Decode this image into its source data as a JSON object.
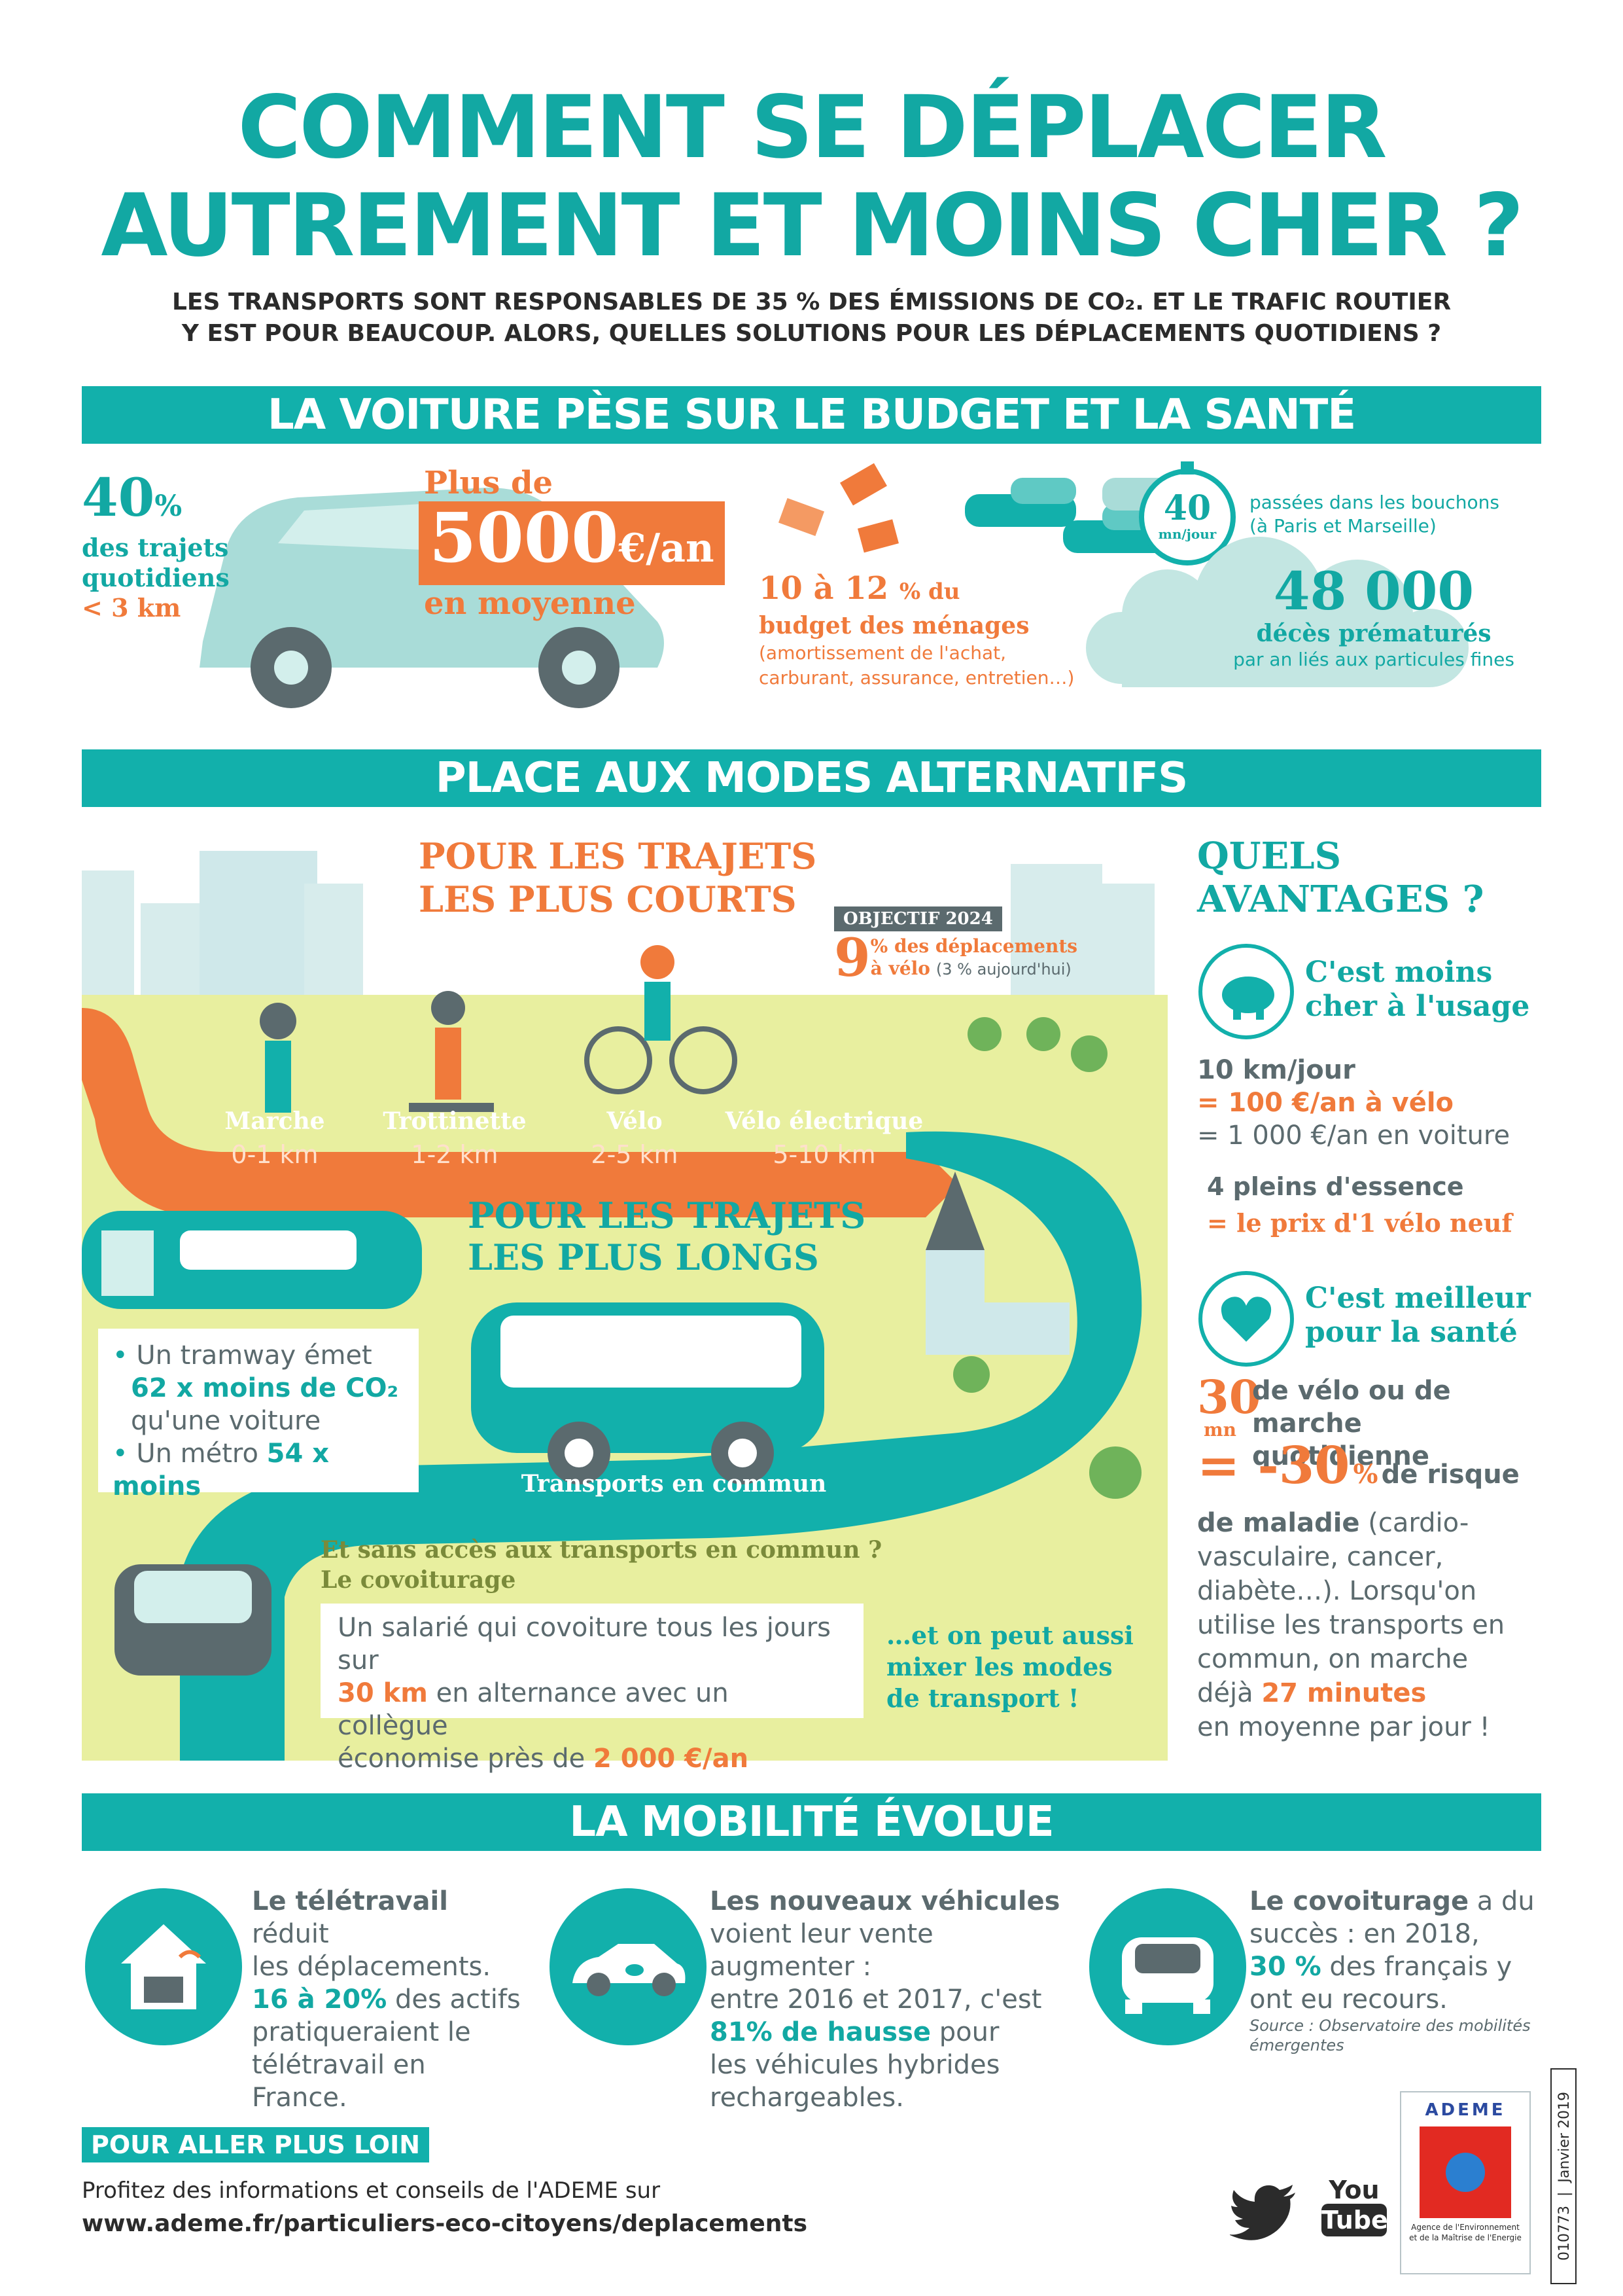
{
  "header": {
    "title_line1": "COMMENT SE DÉPLACER",
    "title_line2": "AUTREMENT ET MOINS CHER ?",
    "subtitle_line1": "LES TRANSPORTS SONT RESPONSABLES DE 35 % DES ÉMISSIONS DE CO₂. ET LE TRAFIC ROUTIER",
    "subtitle_line2": "Y EST POUR BEAUCOUP. ALORS, QUELLES SOLUTIONS POUR LES DÉPLACEMENTS QUOTIDIENS ?"
  },
  "section1": {
    "title": "LA VOITURE PÈSE SUR LE BUDGET ET LA SANTÉ",
    "trips_value": "40",
    "trips_unit": "%",
    "trips_text1": "des trajets",
    "trips_text2": "quotidiens",
    "trips_text3": "< 3 km",
    "cost_prefix": "Plus de",
    "cost_value": "5000",
    "cost_unit": "€/an",
    "cost_suffix": "en moyenne",
    "budget_value": "10 à 12",
    "budget_unit": "% du",
    "budget_text": "budget des ménages",
    "budget_detail1": "(amortissement de l'achat,",
    "budget_detail2": "carburant, assurance, entretien…)",
    "traffic_value": "40",
    "traffic_unit": "mn/jour",
    "traffic_text1": "passées dans les bouchons",
    "traffic_text2": "(à Paris et Marseille)",
    "deaths_value": "48 000",
    "deaths_text1": "décès prématurés",
    "deaths_text2": "par an liés aux particules fines"
  },
  "section2": {
    "title": "PLACE AUX MODES ALTERNATIFS",
    "short_title1": "POUR LES TRAJETS",
    "short_title2": "LES PLUS COURTS",
    "objective_label": "OBJECTIF 2024",
    "objective_value": "9",
    "objective_text1": "% des déplacements",
    "objective_text2": "à vélo",
    "objective_text3": "(3 % aujourd'hui)",
    "modes": [
      {
        "name": "Marche",
        "range": "0-1 km"
      },
      {
        "name": "Trottinette",
        "range": "1-2 km"
      },
      {
        "name": "Vélo",
        "range": "2-5 km"
      },
      {
        "name": "Vélo électrique",
        "range": "5-10 km"
      }
    ],
    "long_title1": "POUR LES TRAJETS",
    "long_title2": "LES PLUS LONGS",
    "tram_line1": "Un tramway émet",
    "tram_line2": "62 x moins de CO₂",
    "tram_line3": "qu'une voiture",
    "metro_prefix": "Un métro",
    "metro_value": "54 x moins",
    "bus_label": "Transports en commun",
    "carpool_q1": "Et sans accès aux transports en commun ?",
    "carpool_q2": "Le covoiturage",
    "carpool_box1": "Un salarié qui covoiture tous les jours sur",
    "carpool_box2a": "30 km",
    "carpool_box2b": "en alternance avec un collègue",
    "carpool_box3a": "économise près de",
    "carpool_box3b": "2 000 €/an",
    "mix1": "…et on peut aussi",
    "mix2": "mixer les modes",
    "mix3": "de transport !"
  },
  "advantages": {
    "title1": "QUELS",
    "title2": "AVANTAGES ?",
    "cheap1": "C'est moins",
    "cheap2": "cher à l'usage",
    "km_line": "10 km/jour",
    "bike_cost": "= 100 €/an à vélo",
    "car_cost": "= 1 000 €/an en voiture",
    "fuel_line": "4 pleins d'essence",
    "fuel_eq": "= le prix d'1 vélo neuf",
    "health1": "C'est meilleur",
    "health2": "pour la santé",
    "minutes_value": "30",
    "minutes_unit": "mn",
    "minutes_text1": "de vélo ou de",
    "minutes_text2": "marche quotidienne",
    "risk_value": "= -30",
    "risk_unit": "%",
    "risk_text": "de risque",
    "disease_bold": "de maladie",
    "disease_text1": "(cardio-",
    "disease_text2": "vasculaire, cancer,",
    "disease_text3": "diabète…). Lorsqu'on",
    "disease_text4": "utilise les transports en",
    "disease_text5": "commun, on marche",
    "disease_text6a": "déjà",
    "disease_text6b": "27 minutes",
    "disease_text7": "en moyenne par jour !"
  },
  "section3": {
    "title": "LA MOBILITÉ ÉVOLUE",
    "col1_bold": "Le télétravail",
    "col1_a": "réduit",
    "col1_b": "les déplacements.",
    "col1_hl": "16 à 20%",
    "col1_c": "des actifs",
    "col1_d": "pratiqueraient le",
    "col1_e": "télétravail en France.",
    "col2_bold": "Les nouveaux véhicules",
    "col2_a": "voient leur vente augmenter :",
    "col2_b": "entre 2016 et 2017, c'est",
    "col2_hl": "81% de hausse",
    "col2_c": "pour",
    "col2_d": "les véhicules hybrides",
    "col2_e": "rechargeables.",
    "col3_bold": "Le covoiturage",
    "col3_a": "a du",
    "col3_b": "succès : en 2018,",
    "col3_hl": "30 %",
    "col3_c": "des français y",
    "col3_d": "ont eu recours.",
    "source1": "Source : Observatoire des mobilités",
    "source2": "émergentes"
  },
  "footer": {
    "more_label": "POUR ALLER PLUS LOIN",
    "more_text": "Profitez des informations et conseils de l'ADEME sur",
    "url": "www.ademe.fr/particuliers-eco-citoyens/deplacements",
    "youtube1": "You",
    "youtube2": "Tube",
    "ademe": "ADEME",
    "ademe_sub1": "Agence de l'Environnement",
    "ademe_sub2": "et de la Maîtrise de l'Energie",
    "ref": "010773",
    "date": "Janvier 2019"
  },
  "colors": {
    "teal": "#12b0ab",
    "orange": "#f07a3b",
    "green_bg": "#e7ef9e",
    "grey": "#5b6a6e"
  },
  "icons": [
    "euro-bill-icon",
    "piggy-bank-icon",
    "heart-icon",
    "home-wifi-icon",
    "electric-car-icon",
    "carpool-car-icon",
    "twitter-icon",
    "youtube-icon",
    "ademe-logo"
  ]
}
